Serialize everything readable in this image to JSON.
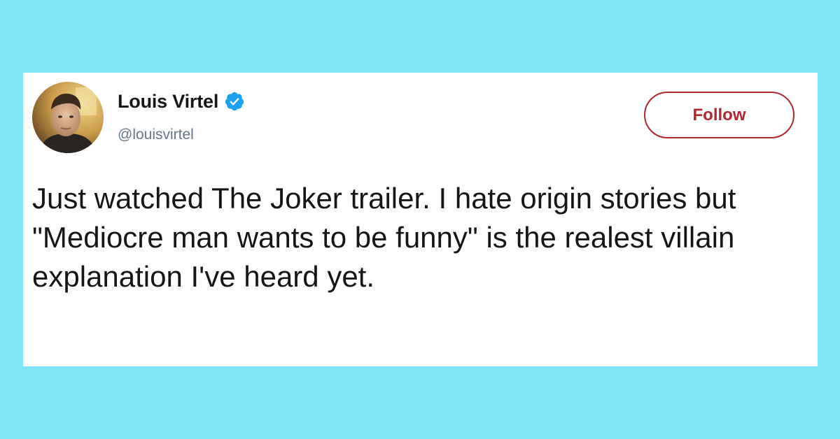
{
  "tweet": {
    "author_name": "Louis Virtel",
    "author_handle": "@louisvirtel",
    "verified": true,
    "follow_label": "Follow",
    "text": "Just watched The Joker trailer. I hate origin stories but \"Mediocre man wants to be funny\" is the realest villain explanation I've heard yet."
  },
  "colors": {
    "page_background": "#7ee4f8",
    "card_background": "#ffffff",
    "follow_accent": "#b0282e",
    "verified_badge": "#1da1f2",
    "handle_text": "#657786"
  },
  "icons": {
    "avatar": "profile-photo",
    "verified": "verified-badge-icon"
  }
}
